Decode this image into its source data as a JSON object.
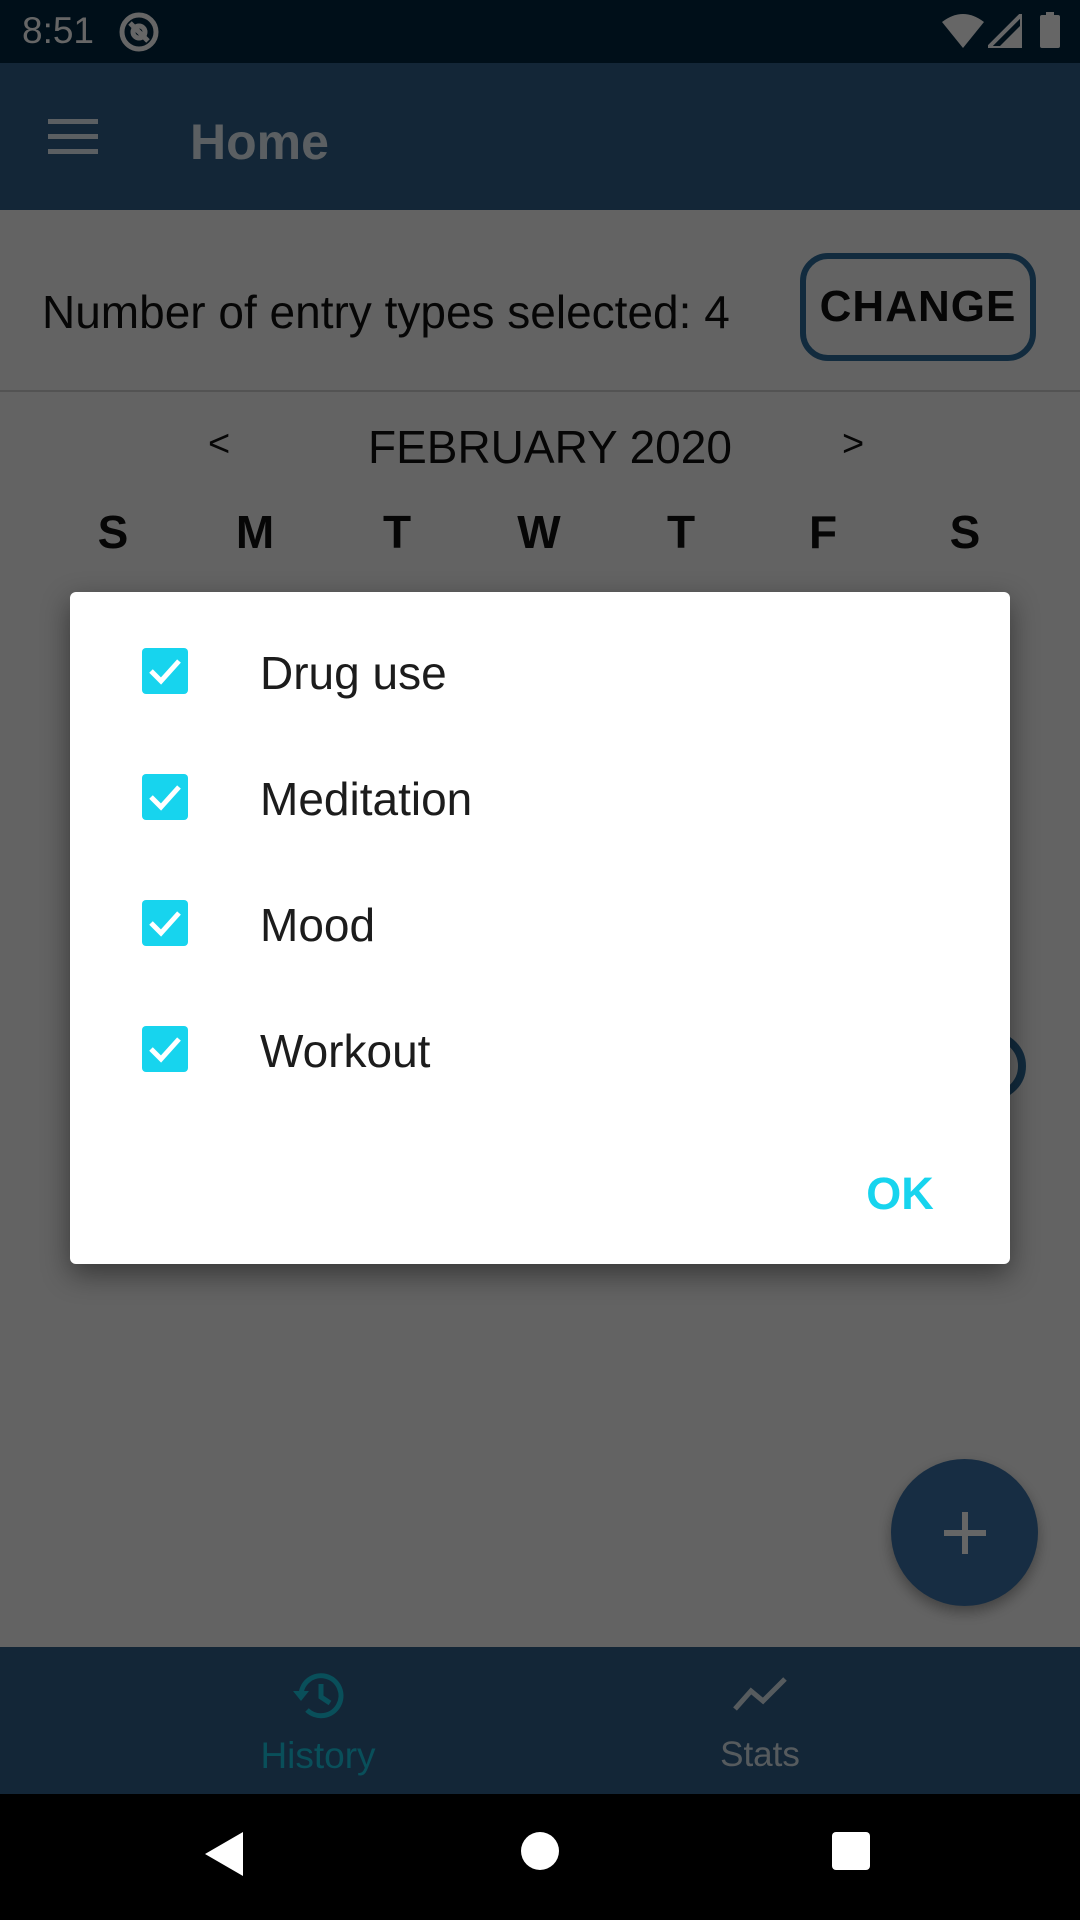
{
  "status_bar": {
    "time": "8:51"
  },
  "app_bar": {
    "title": "Home"
  },
  "filter": {
    "text": "Number of entry types selected: 4",
    "change_label": "CHANGE"
  },
  "calendar": {
    "prev_label": "<",
    "next_label": ">",
    "month_label": "FEBRUARY 2020",
    "weekdays": [
      "S",
      "M",
      "T",
      "W",
      "T",
      "F",
      "S"
    ]
  },
  "dialog": {
    "options": [
      {
        "label": "Drug use",
        "checked": true
      },
      {
        "label": "Meditation",
        "checked": true
      },
      {
        "label": "Mood",
        "checked": true
      },
      {
        "label": "Workout",
        "checked": true
      }
    ],
    "ok_label": "OK"
  },
  "bottom_nav": {
    "items": [
      {
        "label": "History",
        "icon": "history-icon",
        "active": true
      },
      {
        "label": "Stats",
        "icon": "stats-icon",
        "active": false
      }
    ]
  },
  "colors": {
    "status_bar": "#00263f",
    "app_bar": "#305f89",
    "accent": "#17d4ee",
    "active_nav": "#17c5e0"
  }
}
